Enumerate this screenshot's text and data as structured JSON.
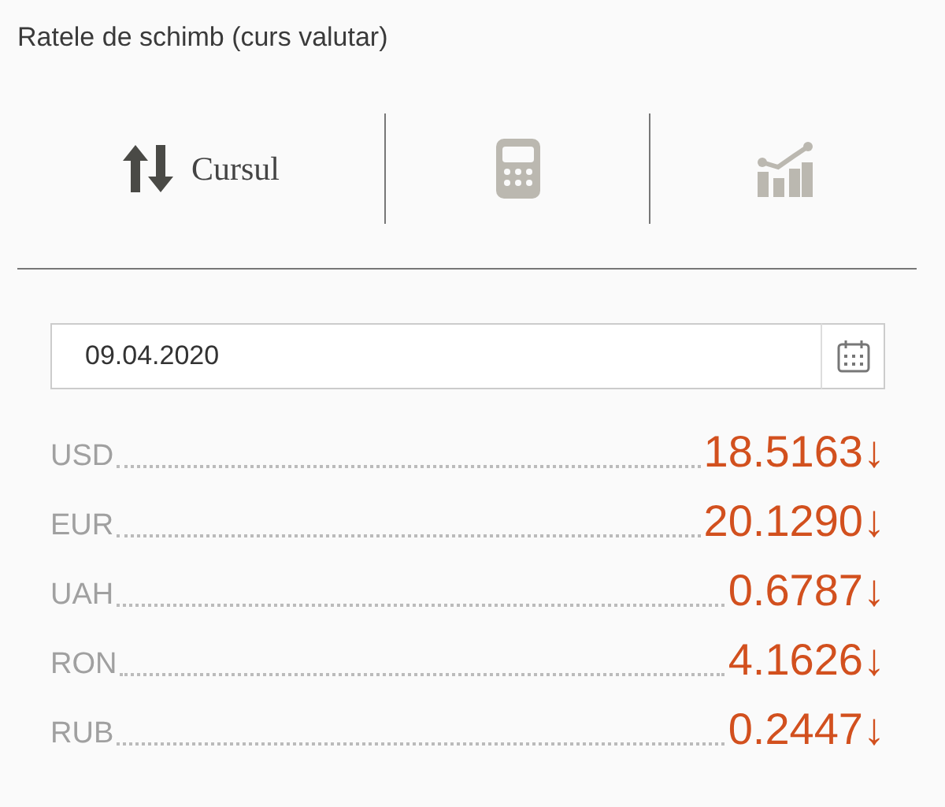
{
  "title": "Ratele de schimb (curs valutar)",
  "tabs": [
    {
      "kind": "arrows",
      "label": "Cursul",
      "selected": true
    },
    {
      "kind": "calculator",
      "selected": false
    },
    {
      "kind": "chart",
      "selected": false
    }
  ],
  "date_field": {
    "value": "09.04.2020"
  },
  "rates": [
    {
      "code": "USD",
      "value": "18.5163",
      "trend": "↓"
    },
    {
      "code": "EUR",
      "value": "20.1290",
      "trend": "↓"
    },
    {
      "code": "UAH",
      "value": "0.6787",
      "trend": "↓"
    },
    {
      "code": "RON",
      "value": "4.1626",
      "trend": "↓"
    },
    {
      "code": "RUB",
      "value": "0.2447",
      "trend": "↓"
    }
  ]
}
